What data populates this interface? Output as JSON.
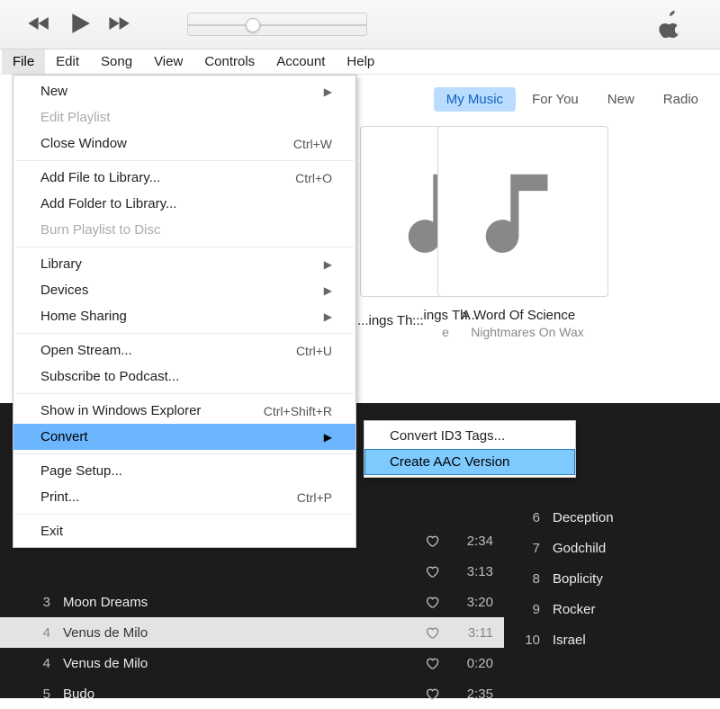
{
  "menubar": [
    "File",
    "Edit",
    "Song",
    "View",
    "Controls",
    "Account",
    "Help"
  ],
  "menubar_open_index": 0,
  "tabs": {
    "items": [
      "My Music",
      "For You",
      "New",
      "Radio"
    ],
    "active_index": 0
  },
  "albums": [
    {
      "title": "...ings Th...",
      "artist": "e"
    },
    {
      "title": "A Word Of Science",
      "artist": "Nightmares On Wax"
    }
  ],
  "songs_left": [
    {
      "n": "",
      "title": "",
      "time": ""
    },
    {
      "n": "",
      "title": "",
      "time": ""
    },
    {
      "n": "",
      "title": "",
      "time": ""
    },
    {
      "n": "",
      "title": "",
      "time": ""
    },
    {
      "n": "",
      "title": "",
      "time": "2:34"
    },
    {
      "n": "",
      "title": "",
      "time": "3:13"
    },
    {
      "n": "3",
      "title": "Moon Dreams",
      "time": "3:20"
    },
    {
      "n": "4",
      "title": "Venus de Milo",
      "time": "3:11",
      "selected": true
    },
    {
      "n": "4",
      "title": "Venus de Milo",
      "time": "0:20"
    },
    {
      "n": "5",
      "title": "Budo",
      "time": "2:35"
    }
  ],
  "songs_right": [
    {
      "n": "6",
      "title": "Deception"
    },
    {
      "n": "7",
      "title": "Godchild"
    },
    {
      "n": "8",
      "title": "Boplicity"
    },
    {
      "n": "9",
      "title": "Rocker"
    },
    {
      "n": "10",
      "title": "Israel"
    }
  ],
  "file_menu": [
    {
      "label": "New",
      "submenu": true
    },
    {
      "label": "Edit Playlist",
      "disabled": true
    },
    {
      "label": "Close Window",
      "shortcut": "Ctrl+W"
    },
    {
      "sep": true
    },
    {
      "label": "Add File to Library...",
      "shortcut": "Ctrl+O"
    },
    {
      "label": "Add Folder to Library..."
    },
    {
      "label": "Burn Playlist to Disc",
      "disabled": true
    },
    {
      "sep": true
    },
    {
      "label": "Library",
      "submenu": true
    },
    {
      "label": "Devices",
      "submenu": true
    },
    {
      "label": "Home Sharing",
      "submenu": true
    },
    {
      "sep": true
    },
    {
      "label": "Open Stream...",
      "shortcut": "Ctrl+U"
    },
    {
      "label": "Subscribe to Podcast..."
    },
    {
      "sep": true
    },
    {
      "label": "Show in Windows Explorer",
      "shortcut": "Ctrl+Shift+R"
    },
    {
      "label": "Convert",
      "submenu": true,
      "highlight": true
    },
    {
      "sep": true
    },
    {
      "label": "Page Setup..."
    },
    {
      "label": "Print...",
      "shortcut": "Ctrl+P"
    },
    {
      "sep": true
    },
    {
      "label": "Exit"
    }
  ],
  "convert_submenu": [
    {
      "label": "Convert ID3 Tags..."
    },
    {
      "label": "Create AAC Version",
      "highlight": true
    }
  ]
}
